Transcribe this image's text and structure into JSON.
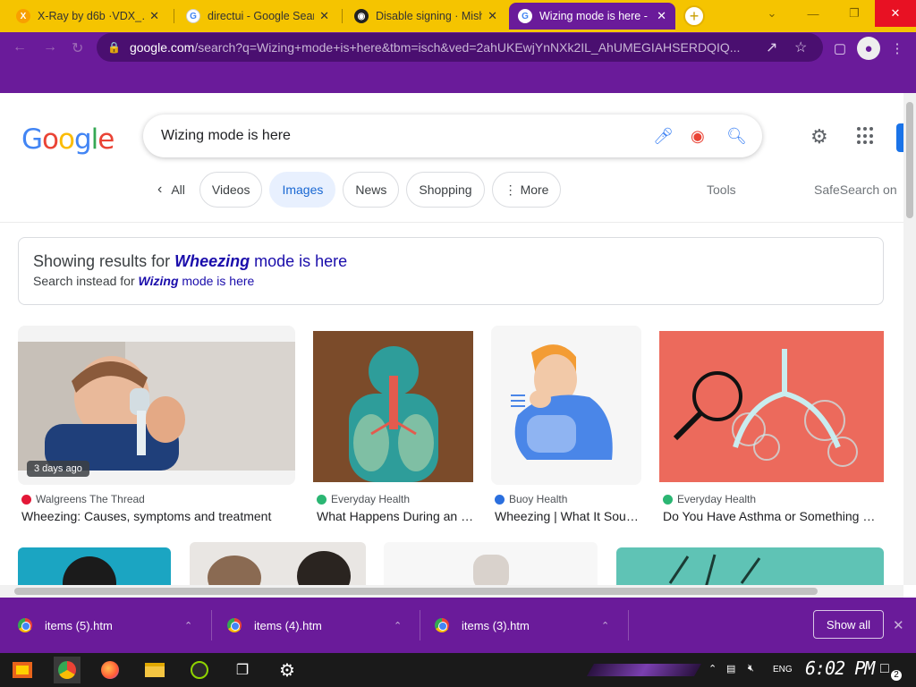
{
  "tabs": [
    {
      "title": "X-Ray by d6b ·VDX_…",
      "close": "✕",
      "favicon": "xray-icon"
    },
    {
      "title": "directui - Google Sear…",
      "close": "✕",
      "favicon": "google-icon"
    },
    {
      "title": "Disable signing · Mish…",
      "close": "✕",
      "favicon": "github-icon"
    },
    {
      "title": "Wizing mode is here - …",
      "close": "✕",
      "favicon": "google-icon"
    }
  ],
  "window": {
    "minimize": "—",
    "restore": "❐",
    "close": "✕",
    "dropdown": "⌄"
  },
  "address": {
    "host": "google.com",
    "path": "/search?q=Wizing+mode+is+here&tbm=isch&ved=2ahUKEwjYnNXk2IL_AhUMEGIAHSERDQIQ..."
  },
  "search": {
    "query": "Wizing mode is here"
  },
  "logo": [
    "G",
    "o",
    "o",
    "g",
    "l",
    "e"
  ],
  "chips": {
    "all": "All",
    "videos": "Videos",
    "images": "Images",
    "news": "News",
    "shopping": "Shopping",
    "more": "More"
  },
  "tools": "Tools",
  "safesearch": "SafeSearch on",
  "spell": {
    "showing_prefix": "Showing results for",
    "corrected_word": "Wheezing",
    "corrected_rest": " mode is here",
    "instead_prefix": "Search instead for",
    "original_word": "Wizing",
    "original_rest": " mode is here"
  },
  "results": [
    {
      "source": "Walgreens The Thread",
      "title": "Wheezing: Causes, symptoms and treatment",
      "badge": "3 days ago"
    },
    {
      "source": "Everyday Health",
      "title": "What Happens During an …"
    },
    {
      "source": "Buoy Health",
      "title": "Wheezing | What It Sou…"
    },
    {
      "source": "Everyday Health",
      "title": "Do You Have Asthma or Something …"
    }
  ],
  "downloads": [
    {
      "name": "items (5).htm"
    },
    {
      "name": "items (4).htm"
    },
    {
      "name": "items (3).htm"
    }
  ],
  "show_all": "Show all",
  "taskbar": {
    "lang": "ENG",
    "time": "6:02 PM",
    "notifications": "2"
  },
  "colors": {
    "chrome_frame": "#6a1b9a",
    "tab_strip": "#f5c400",
    "link": "#1a0dab",
    "active_chip": "#1967d2"
  }
}
